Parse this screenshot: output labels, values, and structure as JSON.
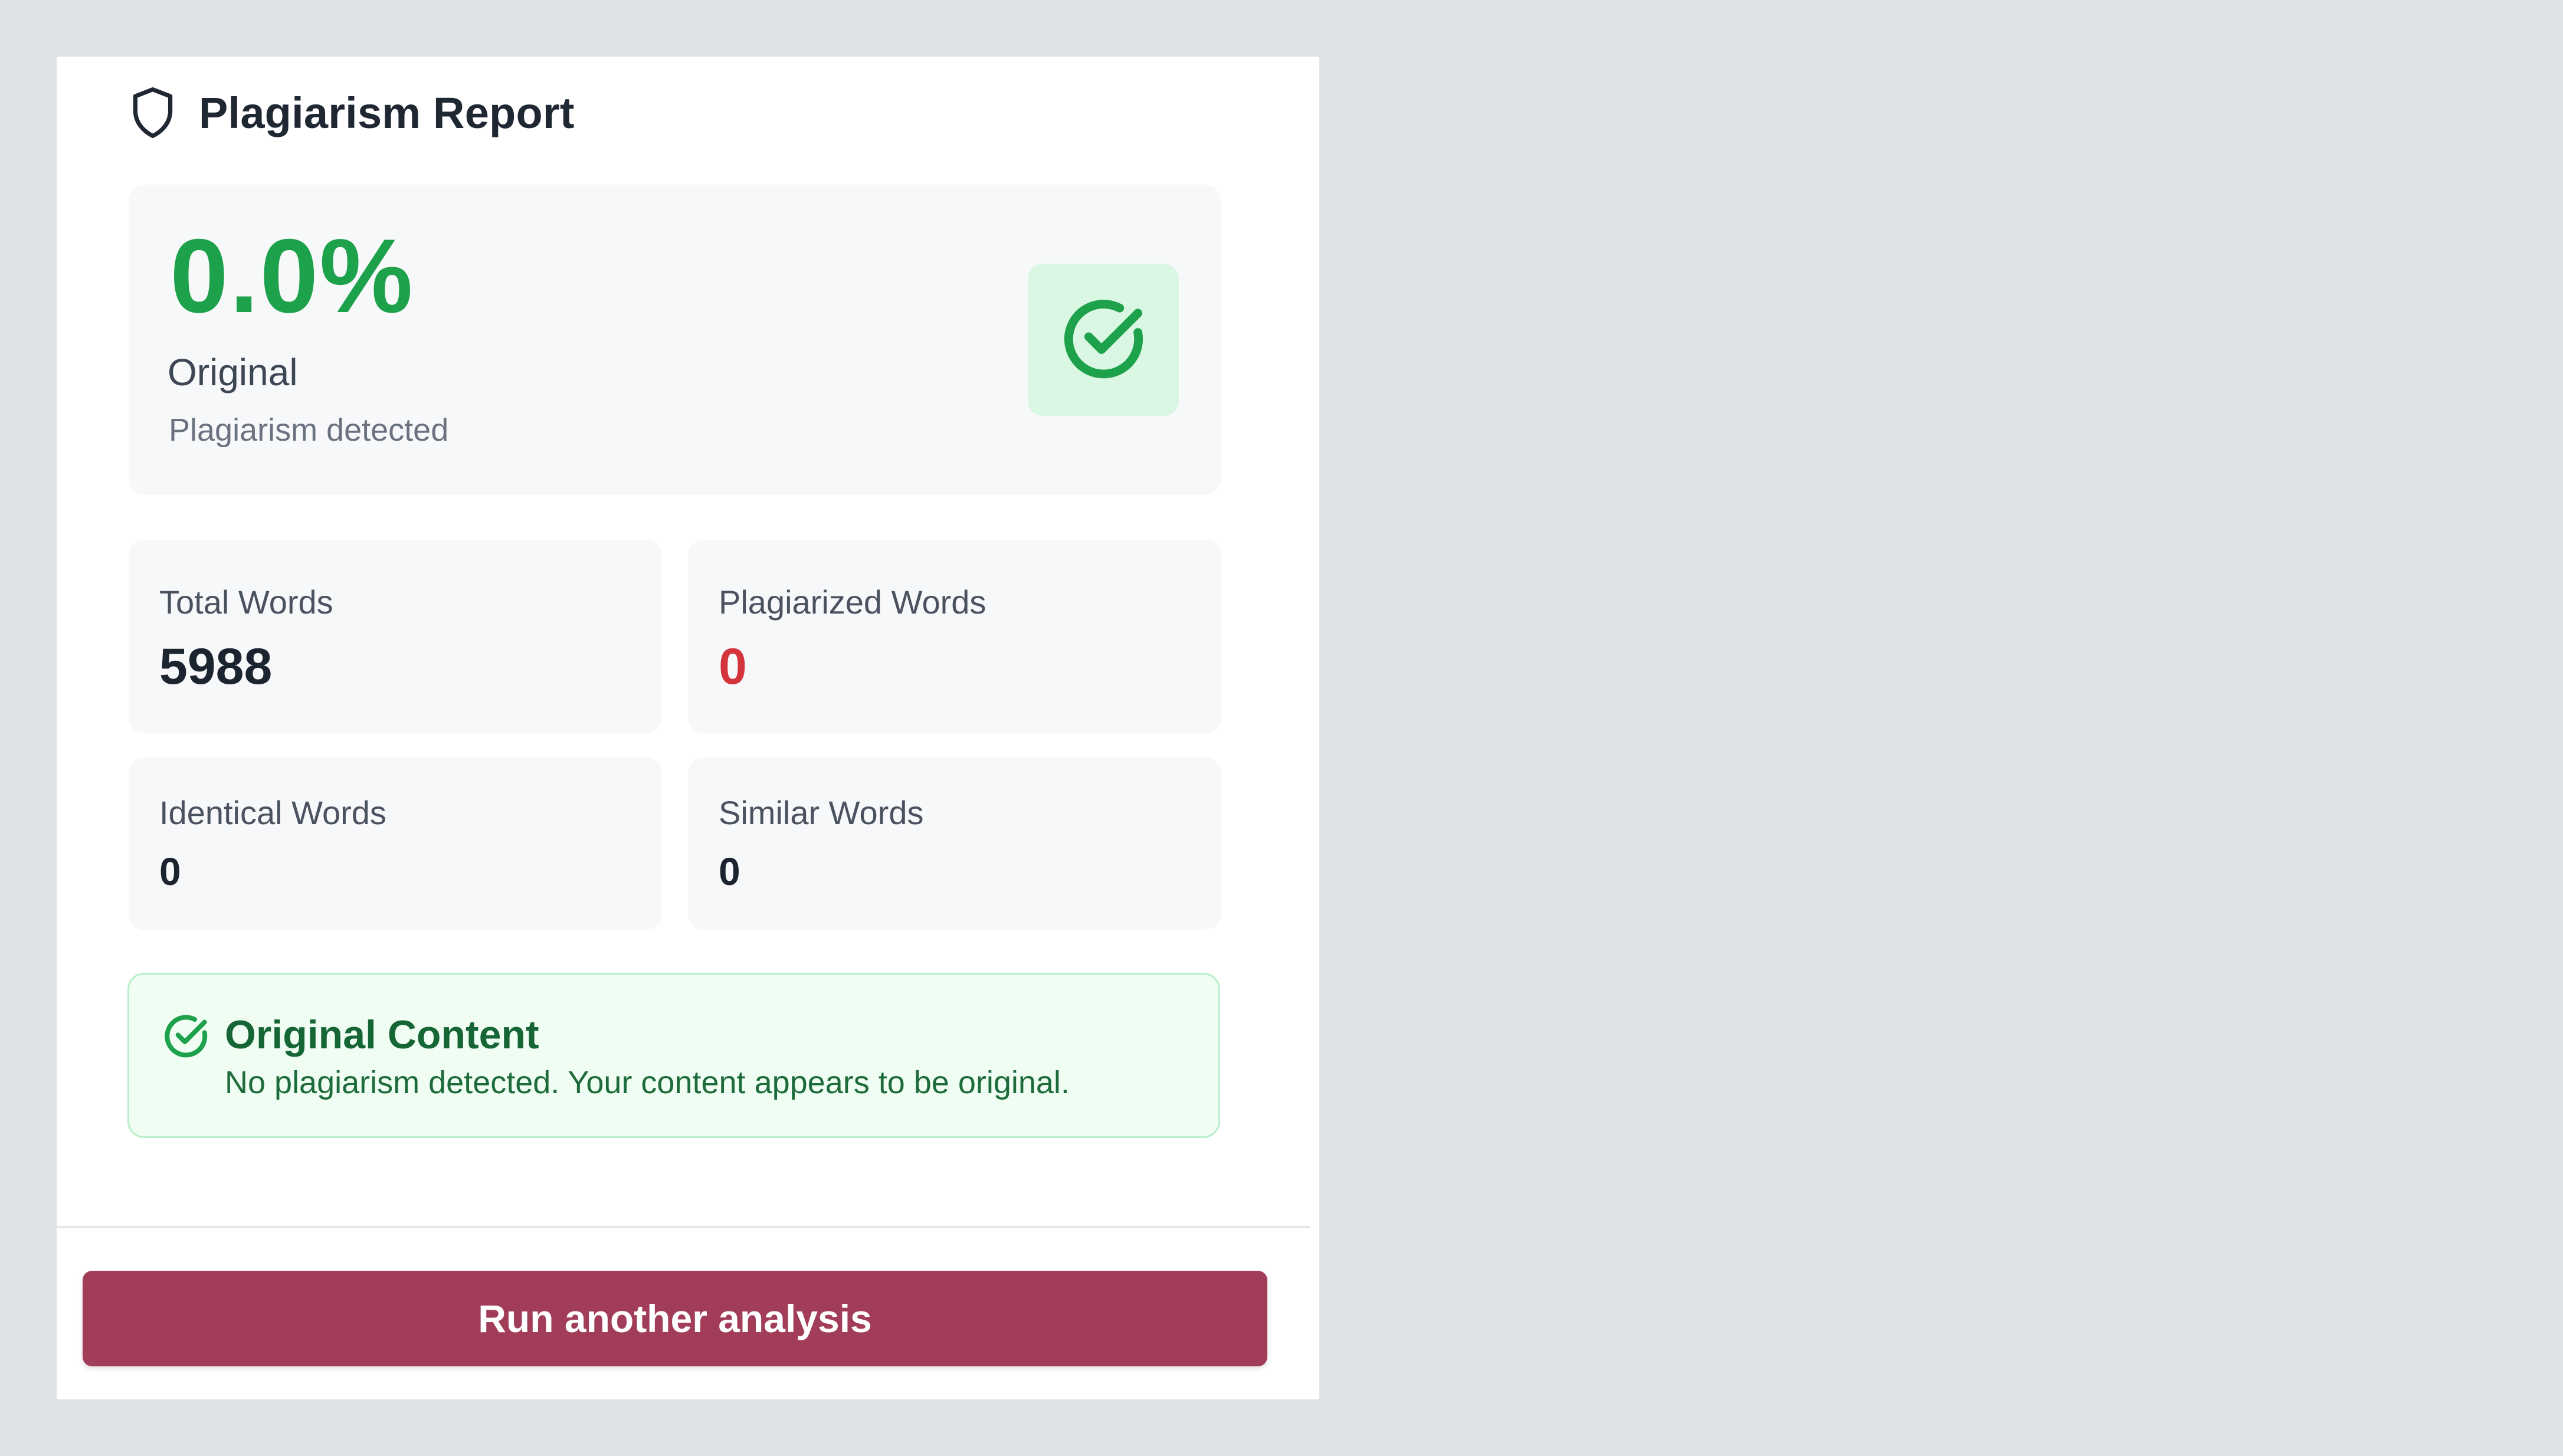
{
  "report": {
    "title": "Plagiarism Report",
    "icons": {
      "header": "shield-icon",
      "score_badge": "check-circle-icon",
      "notice": "check-circle-icon"
    }
  },
  "score": {
    "value": "0.0%",
    "label": "Original",
    "sublabel": "Plagiarism detected"
  },
  "stats": {
    "total_words": {
      "label": "Total Words",
      "value": "5988"
    },
    "plagiarized_words": {
      "label": "Plagiarized Words",
      "value": "0"
    },
    "identical_words": {
      "label": "Identical Words",
      "value": "0"
    },
    "similar_words": {
      "label": "Similar Words",
      "value": "0"
    }
  },
  "notice": {
    "title": "Original Content",
    "text": "No plagiarism detected. Your content appears to be original."
  },
  "actions": {
    "run_again_label": "Run another analysis"
  },
  "colors": {
    "background": "#dfe2e7",
    "success": "#1ea14b",
    "danger": "#d4343c",
    "button": "#a13d59",
    "notice_bg": "#effdf3"
  }
}
